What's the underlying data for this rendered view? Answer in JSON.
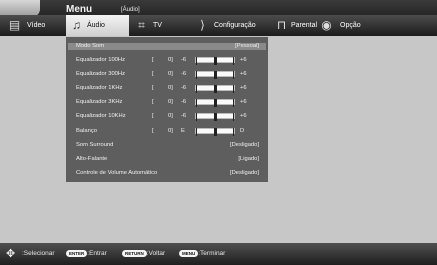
{
  "header": {
    "menu_title": "Menu",
    "menu_sub": "[Áudio]"
  },
  "tabs": [
    {
      "label": "Vídeo",
      "icon": "video-icon"
    },
    {
      "label": "Áudio",
      "icon": "audio-icon",
      "active": true
    },
    {
      "label": "TV",
      "icon": "tv-icon"
    },
    {
      "label": "Configuração",
      "icon": "setup-icon"
    },
    {
      "label": "Parental",
      "icon": "lock-icon"
    },
    {
      "label": "Opção",
      "icon": "option-icon"
    }
  ],
  "audio": {
    "modo_som": {
      "label": "Modo Som",
      "value": "[Pessoal]"
    },
    "eq100": {
      "label": "Equalizador 100Hz",
      "bracket": "[",
      "value": "0]",
      "min": "-6",
      "max": "+6",
      "level": 0
    },
    "eq300": {
      "label": "Equalizador 300Hz",
      "bracket": "[",
      "value": "0]",
      "min": "-6",
      "max": "+6",
      "level": 0
    },
    "eq1k": {
      "label": "Equalizador 1KHz",
      "bracket": "[",
      "value": "0]",
      "min": "-6",
      "max": "+6",
      "level": 0
    },
    "eq3k": {
      "label": "Equalizador 3KHz",
      "bracket": "[",
      "value": "0]",
      "min": "-6",
      "max": "+6",
      "level": 0
    },
    "eq10k": {
      "label": "Equalizador 10KHz",
      "bracket": "[",
      "value": "0]",
      "min": "-6",
      "max": "+6",
      "level": 0
    },
    "balanco": {
      "label": "Balanço",
      "bracket": "[",
      "value": "0]",
      "min": "E",
      "max": "D",
      "level": 0
    },
    "surround": {
      "label": "Som Surround",
      "value": "[Desligado]"
    },
    "alto_falante": {
      "label": "Alto-Falante",
      "value": "[Ligado]"
    },
    "avc": {
      "label": "Controle de Volume Automático",
      "value": "[Desligado]"
    }
  },
  "footer": {
    "select": ":Selecionar",
    "enter_key": "ENTER",
    "enter": ":Entrar",
    "return_key": "RETURN",
    "return": ":Voltar",
    "menu_key": "MENU",
    "menu": ":Terminar"
  }
}
